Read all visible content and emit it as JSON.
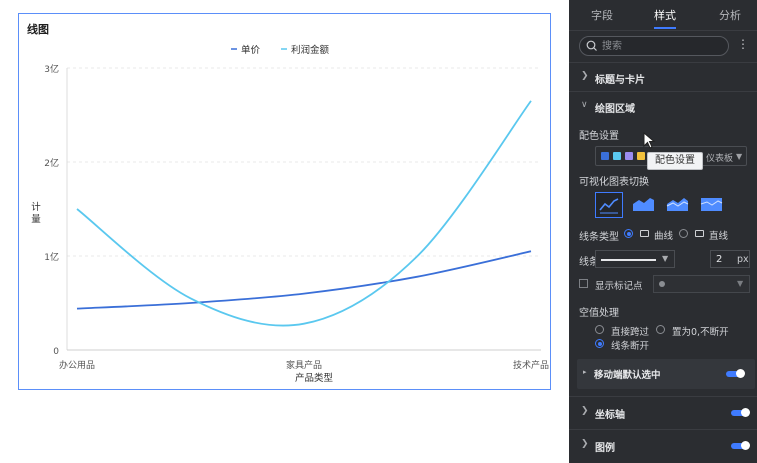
{
  "chart": {
    "title": "线图",
    "legend": [
      {
        "label": "单价",
        "color": "#3a6fd8"
      },
      {
        "label": "利润金额",
        "color": "#5ac8ef"
      }
    ],
    "y_axis_title": "计\n量",
    "x_axis_title": "产品类型"
  },
  "chart_data": {
    "type": "line",
    "title": "线图",
    "xlabel": "产品类型",
    "ylabel": "计量",
    "categories": [
      "办公用品",
      "家具产品",
      "技术产品"
    ],
    "y_ticks": [
      "0",
      "1亿",
      "2亿",
      "3亿"
    ],
    "ylim": [
      0,
      3
    ],
    "y_unit": "亿",
    "grid": true,
    "legend_position": "top",
    "smooth": true,
    "series": [
      {
        "name": "单价",
        "color": "#3a6fd8",
        "x": [
          0,
          0.5,
          1,
          1.5,
          2
        ],
        "values": [
          0.44,
          0.5,
          0.6,
          0.78,
          1.05
        ]
      },
      {
        "name": "利润金额",
        "color": "#5ac8ef",
        "x": [
          0,
          0.5,
          1,
          1.5,
          2
        ],
        "values": [
          1.5,
          0.55,
          0.28,
          1.0,
          2.65
        ]
      }
    ]
  },
  "panel": {
    "tabs": [
      "字段",
      "样式",
      "分析"
    ],
    "active_tab": "样式",
    "search_placeholder": "搜索",
    "more_label": "⋮",
    "sections": {
      "title_card": "标题与卡片",
      "plot_area": "绘图区域",
      "axis": "坐标轴",
      "legend": "图例",
      "mobile": "移动端默认选中"
    },
    "color_setting_label": "配色设置",
    "palette": {
      "name": "仪表板",
      "swatches": [
        "#3a6fd8",
        "#5ac8ef",
        "#9b8cf0",
        "#f3c13c",
        "#45c38f"
      ]
    },
    "tooltip": "配色设置",
    "viz_switch_label": "可视化图表切换",
    "line_type_label": "线条类型",
    "line_type_options": [
      "曲线",
      "直线"
    ],
    "line_style_label": "线条样式",
    "line_width_value": "2",
    "line_width_unit": "px",
    "show_markers_label": "显示标记点",
    "null_handling_label": "空值处理",
    "null_options": [
      "直接跨过",
      "置为0,不断开",
      "线条断开"
    ],
    "selected_null_option": "线条断开",
    "selected_line_type": "曲线"
  }
}
